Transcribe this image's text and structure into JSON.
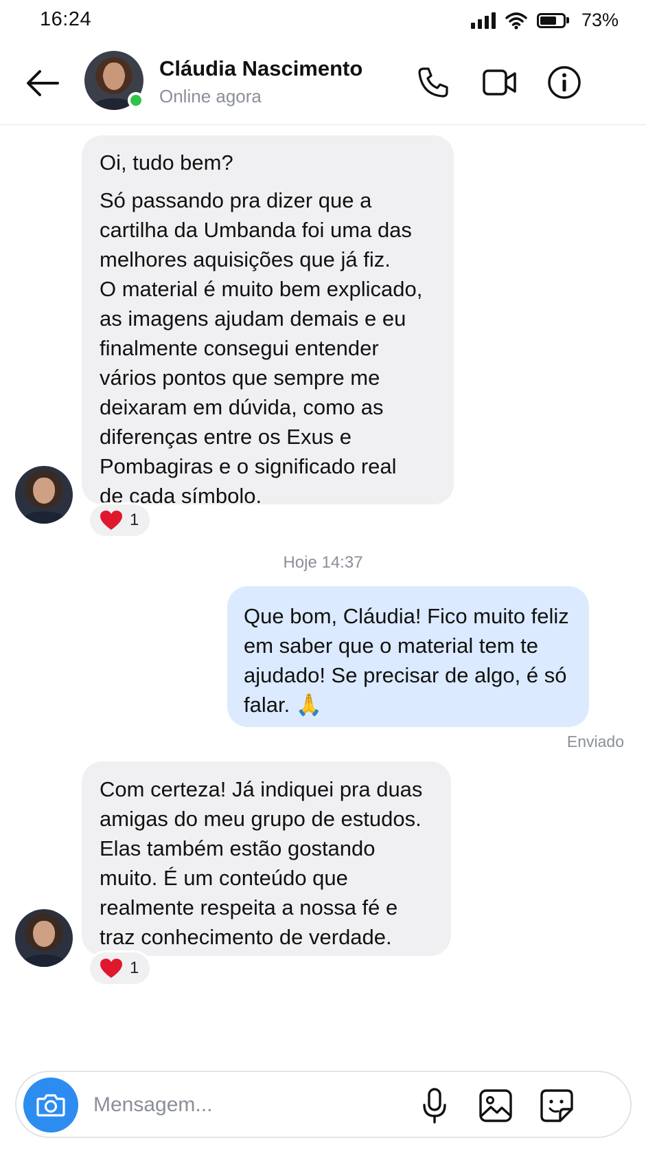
{
  "status_bar": {
    "time": "16:24",
    "battery_percent": "73%",
    "battery_level": 0.73
  },
  "header": {
    "contact_name": "Cláudia Nascimento",
    "contact_status": "Online agora",
    "icons": [
      "back-arrow-icon",
      "phone-icon",
      "video-camera-icon",
      "info-icon"
    ]
  },
  "messages": {
    "msg1": {
      "greeting": "Oi, tudo bem?",
      "lines": [
        "Só passando pra dizer que a",
        "cartilha da Umbanda foi uma das",
        "melhores aquisições que já fiz.",
        "O material é muito bem explicado,",
        "as imagens ajudam demais e eu",
        "finalmente consegui entender",
        "vários pontos que sempre me",
        "deixaram em dúvida, como as",
        "diferenças entre os Exus e",
        "Pombagiras e o significado real",
        "de cada símbolo."
      ],
      "reaction_count": "1"
    },
    "timestamp": "Hoje 14:37",
    "msg2": {
      "lines": [
        "Que bom, Cláudia! Fico muito feliz",
        "em saber que o material tem te",
        "ajudado! Se precisar de algo, é só",
        "falar. 🙏"
      ],
      "status": "Enviado"
    },
    "msg3": {
      "lines": [
        "Com certeza! Já indiquei pra duas",
        "amigas do meu grupo de estudos.",
        "Elas também estão gostando",
        "muito. É um conteúdo que",
        "realmente respeita a nossa fé e",
        "traz conhecimento de verdade."
      ],
      "reaction_count": "1"
    }
  },
  "composer": {
    "placeholder": "Mensagem...",
    "icons": [
      "camera-icon",
      "microphone-icon",
      "image-icon",
      "sticker-icon"
    ]
  },
  "colors": {
    "accent": "#2d8cf0",
    "online": "#31c24a",
    "outgoing_bubble": "#dbeafe",
    "incoming_bubble": "#f0f0f2",
    "heart": "#e0182d"
  }
}
